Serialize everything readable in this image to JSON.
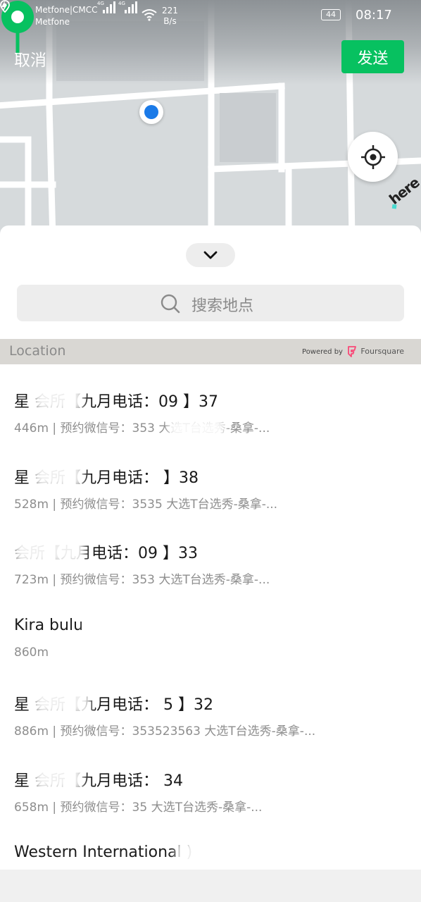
{
  "status_bar": {
    "carrier_primary": "Metfone|CMCC",
    "carrier_secondary": "Metfone",
    "signal_1_label": "4G",
    "signal_2_label": "4G",
    "net_speed_value": "221",
    "net_speed_unit": "B/s",
    "battery_level": "44",
    "time": "08:17"
  },
  "header": {
    "cancel_label": "取消",
    "send_label": "发送"
  },
  "map": {
    "provider": "here",
    "pin_color": "#07c160",
    "my_location_color": "#1a7ae8"
  },
  "search": {
    "placeholder": "搜索地点"
  },
  "location_section": {
    "label": "Location",
    "powered_by": "Powered by",
    "provider_name": "Foursquare"
  },
  "places": [
    {
      "name": "星        会所【九月电话：09                    】37",
      "sub": "446m | 预约微信号：353                大选T台选秀-桑拿-..."
    },
    {
      "name": "星              会所【九月电话：                        】38",
      "sub": "528m | 预约微信号：3535                大选T台选秀-桑拿-..."
    },
    {
      "name": "                会所【九月电话：09                    】33",
      "sub": "723m | 预约微信号：353                大选T台选秀-桑拿-..."
    },
    {
      "name": "Kira bulu",
      "sub": "860m"
    },
    {
      "name": "星              会所【九月电话：               5          】32",
      "sub": "886m | 预约微信号：353523563   大选T台选秀-桑拿-..."
    },
    {
      "name": "星              会所【九月电话：                            34",
      "sub": "658m | 预约微信号：35                大选T台选秀-桑拿-..."
    },
    {
      "name": "Western International                                      )",
      "sub": ""
    }
  ],
  "colors": {
    "accent_green": "#07c160",
    "header_band": "#d9d7d3"
  }
}
